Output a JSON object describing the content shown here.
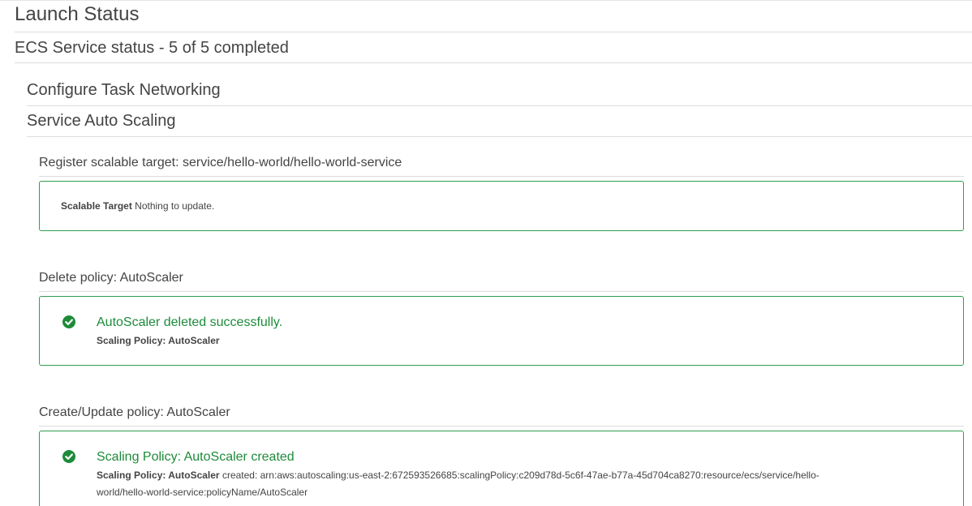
{
  "page": {
    "title": "Launch Status"
  },
  "ecs": {
    "status_title": "ECS Service status - 5 of 5 completed"
  },
  "subsections": {
    "configure_networking": "Configure Task Networking",
    "service_auto_scaling": "Service Auto Scaling"
  },
  "steps": [
    {
      "title": "Register scalable target: service/hello-world/hello-world-service",
      "box_label": "Scalable Target",
      "box_text": "Nothing to update."
    },
    {
      "title": "Delete policy: AutoScaler",
      "message": "AutoScaler deleted successfully.",
      "detail_label": "Scaling Policy: AutoScaler",
      "icon": "check-circle-icon"
    },
    {
      "title": "Create/Update policy: AutoScaler",
      "message": "Scaling Policy: AutoScaler created",
      "detail_label": "Scaling Policy: AutoScaler",
      "detail_text_1": " created: arn:aws:autoscaling:us-east-2:672593526685:scalingPolicy:c209d78d-5c6f-47ae-b77a-45d704ca8270:resource/ecs/service/hello-",
      "detail_text_2": "world/hello-world-service:policyName/AutoScaler",
      "icon": "check-circle-icon"
    }
  ],
  "colors": {
    "success_green": "#1d8b3a",
    "border_green": "#2e9e4f",
    "heading_gray": "#444444",
    "rule_gray": "#dddddd"
  }
}
